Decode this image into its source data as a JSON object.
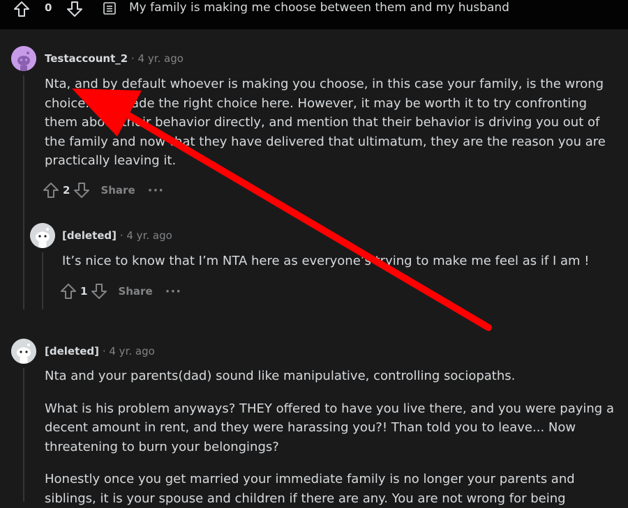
{
  "topbar": {
    "vote_count": "0",
    "post_title": "My family is making me choose between them and my husband"
  },
  "comments": [
    {
      "username": "Testaccount_2",
      "separator": "·",
      "time": "4 yr. ago",
      "paragraphs": [
        "Nta, and by default whoever is making you choose, in this case your family, is the wrong choice. You made the right choice here. However, it may be worth it to try confronting them about their behavior directly, and mention that their behavior is driving you out of the family and now that they have delivered that ultimatum, they are the reason you are practically leaving it."
      ],
      "lines": [
        "Nta, and by default whoever is making you choose, in this case your family, is the wrong",
        "choice. You made the right choice here. However, it may be worth it to try confronting",
        "them about their behavior directly, and mention that their behavior is driving you out of",
        "the family and now that they have delivered that ultimatum, they are the reason you are",
        "practically leaving it."
      ],
      "votes": "2",
      "share_label": "Share",
      "more_label": "···"
    },
    {
      "username": "[deleted]",
      "separator": "·",
      "time": "4 yr. ago",
      "lines": [
        "It’s nice to know that I’m NTA here as everyone’s trying to make me feel as if I am !"
      ],
      "votes": "1",
      "share_label": "Share",
      "more_label": "···"
    },
    {
      "username": "[deleted]",
      "separator": "·",
      "time": "4 yr. ago",
      "lines": [
        "Nta and your parents(dad) sound like manipulative, controlling sociopaths.",
        "What is his problem anyways? THEY offered to have you live there, and you were paying a",
        "decent amount in rent, and they were harassing you?! Than told you to leave... Now",
        "threatening to burn your belongings?",
        "Honestly once you get married your immediate family is no longer your parents and",
        "siblings, it is your spouse and children if there are any. You are not wrong for being"
      ]
    }
  ],
  "colors": {
    "background": "#1a1a1b",
    "topbar": "#030303",
    "text": "#d7dadc",
    "muted": "#818384",
    "annotation_arrow": "#ff0000",
    "avatar1": "#c89be8"
  },
  "icons": {
    "upvote": "arrow-up-outline",
    "downvote": "arrow-down-outline",
    "post": "document-lines",
    "annotation": "red-arrow"
  }
}
